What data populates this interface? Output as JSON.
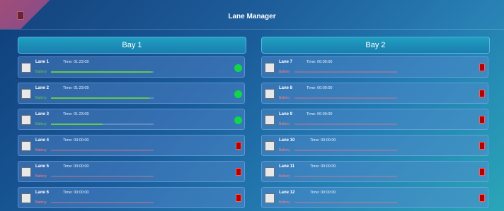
{
  "app": {
    "title": "Lane Manager"
  },
  "icons": {
    "corner": "document-icon",
    "status_on": "green-dot-icon",
    "status_off": "red-battery-icon"
  },
  "colors": {
    "green": "#0fd64b",
    "red": "#ff3c3c",
    "battery_ok": "#63c84d",
    "battery_bad": "#ff7b7b"
  },
  "bays": [
    {
      "label": "Bay 1",
      "lanes": [
        {
          "label": "Lane 1",
          "time": "Time: 01:23:09",
          "battery": "Battery",
          "status": "online",
          "battery_fraction": 0.98
        },
        {
          "label": "Lane 2",
          "time": "Time: 01:23:09",
          "battery": "Battery",
          "status": "online",
          "battery_fraction": 0.96
        },
        {
          "label": "Lane 3",
          "time": "Time: 01:23:09",
          "battery": "Battery",
          "status": "online",
          "battery_fraction": 0.5
        },
        {
          "label": "Lane 4",
          "time": "Time: 00:00:00",
          "battery": "Battery",
          "status": "offline",
          "battery_fraction": 0.0
        },
        {
          "label": "Lane 5",
          "time": "Time: 00:00:00",
          "battery": "Battery",
          "status": "offline",
          "battery_fraction": 0.0
        },
        {
          "label": "Lane 6",
          "time": "Time: 00:00:00",
          "battery": "Battery",
          "status": "offline",
          "battery_fraction": 0.0
        }
      ]
    },
    {
      "label": "Bay 2",
      "lanes": [
        {
          "label": "Lane 7",
          "time": "Time: 00:00:00",
          "battery": "Battery",
          "status": "offline",
          "battery_fraction": 0.0
        },
        {
          "label": "Lane 8",
          "time": "Time: 00:00:00",
          "battery": "Battery",
          "status": "offline",
          "battery_fraction": 0.0
        },
        {
          "label": "Lane 9",
          "time": "Time: 00:00:00",
          "battery": "Battery",
          "status": "offline",
          "battery_fraction": 0.0
        },
        {
          "label": "Lane 10",
          "time": "Time: 00:00:00",
          "battery": "Battery",
          "status": "offline",
          "battery_fraction": 0.0
        },
        {
          "label": "Lane 11",
          "time": "Time: 00:00:00",
          "battery": "Battery",
          "status": "offline",
          "battery_fraction": 0.0
        },
        {
          "label": "Lane 12",
          "time": "Time: 00:00:00",
          "battery": "Battery",
          "status": "offline",
          "battery_fraction": 0.0
        }
      ]
    }
  ]
}
